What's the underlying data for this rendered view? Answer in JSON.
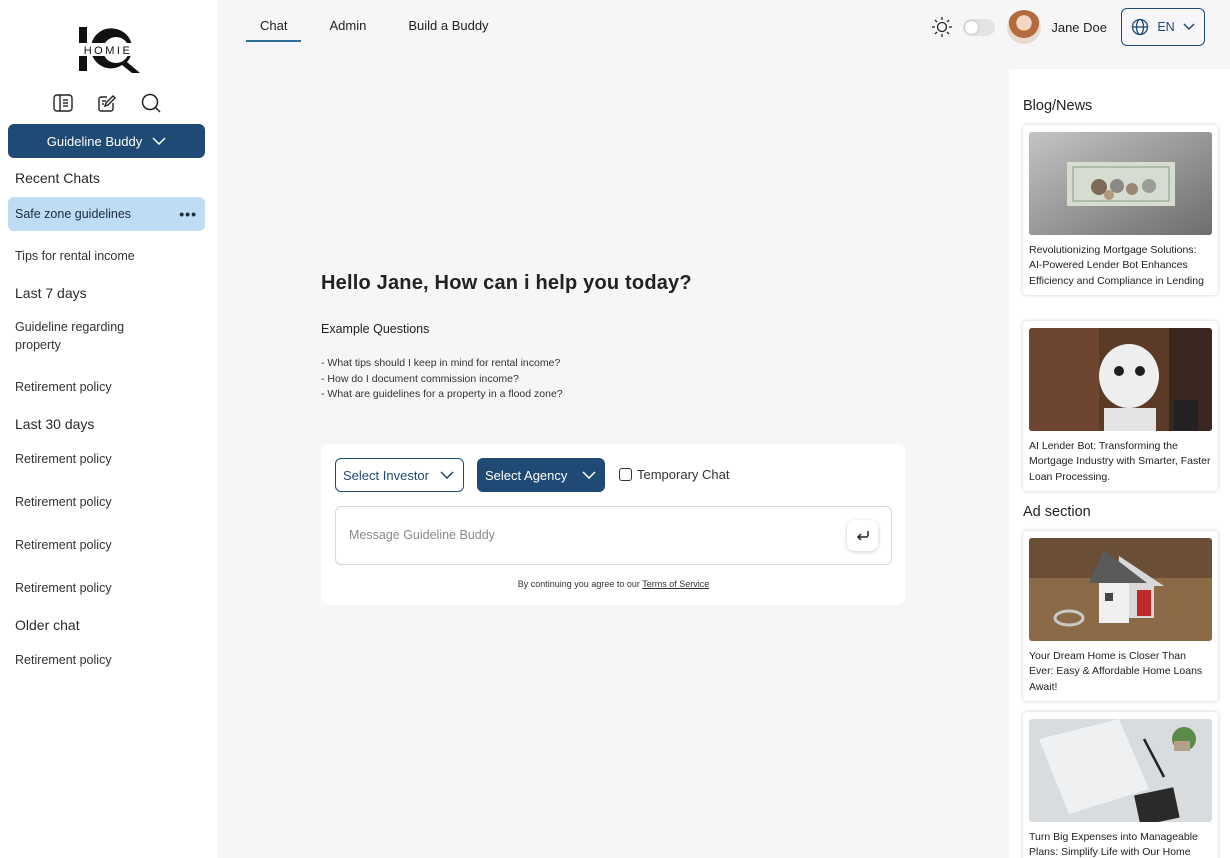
{
  "app": {
    "logo_text": "HOMIE",
    "logo_mark": "IQ"
  },
  "sidebar": {
    "buddy_selector": "Guideline Buddy",
    "recent_title": "Recent Chats",
    "active_chat": "Safe zone guidelines",
    "recent_items": [
      "Tips for rental income"
    ],
    "last7_title": "Last 7 days",
    "last7_items": [
      "Guideline regarding property",
      "Retirement policy"
    ],
    "last30_title": "Last 30 days",
    "last30_items": [
      "Retirement policy",
      "Retirement policy",
      "Retirement policy",
      "Retirement policy"
    ],
    "older_title": "Older chat",
    "older_items": [
      "Retirement policy"
    ]
  },
  "header": {
    "tabs": [
      "Chat",
      "Admin",
      "Build a Buddy"
    ],
    "active_tab": "Chat",
    "user_name": "Jane Doe",
    "language": "EN"
  },
  "main": {
    "greeting": "Hello Jane, How can i help you today?",
    "examples_title": "Example Questions",
    "examples": [
      "- What tips should I keep in mind for rental income?",
      "- How do I document commission income?",
      "- What are guidelines for a property in a flood zone?"
    ],
    "select_investor": "Select Investor",
    "select_agency": "Select Agency",
    "temporary_chat": "Temporary Chat",
    "message_placeholder": "Message Guideline Buddy",
    "terms_prefix": "By continuing you agree to our",
    "terms_link": "Terms of Service"
  },
  "right_panel": {
    "blog_title": "Blog/News",
    "blog_cards": [
      "Revolutionizing Mortgage Solutions: AI-Powered Lender Bot Enhances Efficiency and Compliance in Lending",
      "AI Lender Bot: Transforming the Mortgage Industry with Smarter, Faster Loan Processing."
    ],
    "ad_title": "Ad section",
    "ad_cards": [
      "Your Dream Home is Closer Than Ever: Easy & Affordable Home Loans Await!",
      "Turn Big Expenses into Manageable Plans: Simplify Life with Our Home"
    ]
  },
  "colors": {
    "primary": "#1f4a75",
    "active_chat_bg": "#bfdcf5",
    "tab_underline": "#2f6d96",
    "page_bg": "#f6f6f8"
  }
}
